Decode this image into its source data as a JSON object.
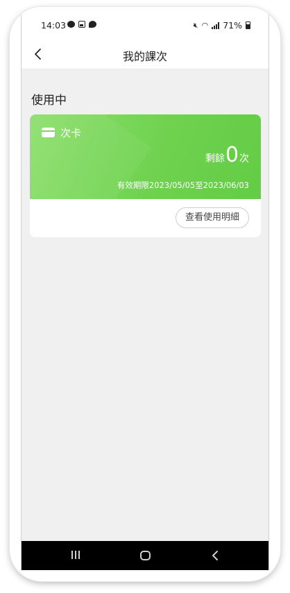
{
  "status_bar": {
    "time": "14:03",
    "battery": "71%"
  },
  "nav": {
    "title": "我的課次"
  },
  "section": {
    "title": "使用中"
  },
  "card": {
    "name": "次卡",
    "remaining_label": "剩餘",
    "remaining_count": "0",
    "remaining_unit": "次",
    "validity": "有效期限2023/05/05至2023/06/03",
    "detail_button": "查看使用明細",
    "gradient_start": "#8de06e",
    "gradient_end": "#63cc45"
  },
  "icons": {
    "back": "chevron-left-icon",
    "card": "credit-card-icon",
    "recent_apps": "recent-apps-icon",
    "home": "home-icon",
    "system_back": "system-back-icon"
  }
}
